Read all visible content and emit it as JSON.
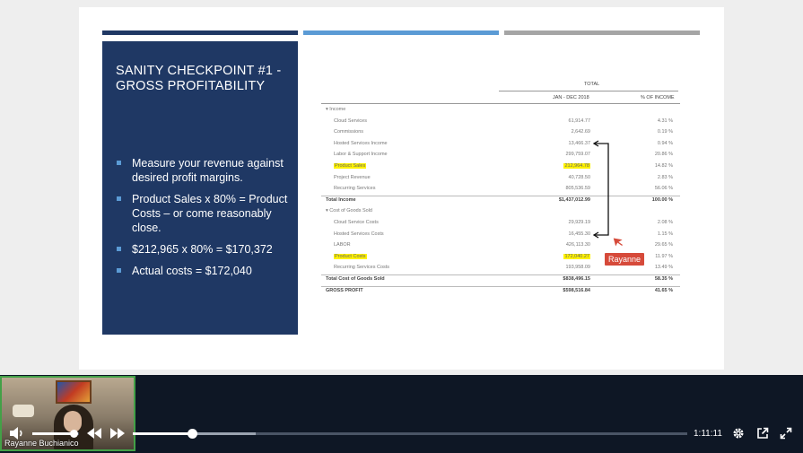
{
  "slide": {
    "title": "SANITY CHECKPOINT #1 -\nGROSS PROFITABILITY",
    "bullets": [
      "Measure your revenue against desired profit margins.",
      "Product Sales x 80% = Product Costs – or come reasonably close.",
      "$212,965 x 80% = $170,372",
      "Actual costs = $172,040"
    ],
    "colors": {
      "panel": "#1f3864",
      "bar_accent": "#5b9bd5",
      "bar_gray": "#a5a5a5",
      "highlight": "#fff200"
    }
  },
  "report": {
    "col_total": "TOTAL",
    "col_period": "JAN - DEC 2018",
    "col_pct": "% OF INCOME",
    "rows": [
      {
        "label": "▾ Income",
        "amount": "",
        "pct": "",
        "indent": 0
      },
      {
        "label": "Cloud Services",
        "amount": "61,914.77",
        "pct": "4.31 %",
        "indent": 1
      },
      {
        "label": "Commissions",
        "amount": "2,642.69",
        "pct": "0.19 %",
        "indent": 1
      },
      {
        "label": "Hosted Services Income",
        "amount": "13,466.37",
        "pct": "0.94 %",
        "indent": 1
      },
      {
        "label": "Labor & Support Income",
        "amount": "299,759.07",
        "pct": "20.86 %",
        "indent": 1
      },
      {
        "label": "Product Sales",
        "amount": "212,964.78",
        "pct": "14.82 %",
        "indent": 1,
        "highlight": true
      },
      {
        "label": "Project Revenue",
        "amount": "40,728.50",
        "pct": "2.83 %",
        "indent": 1
      },
      {
        "label": "Recurring Services",
        "amount": "805,536.59",
        "pct": "56.06 %",
        "indent": 1
      },
      {
        "label": "Total Income",
        "amount": "$1,437,012.99",
        "pct": "100.00 %",
        "indent": 0,
        "total": true
      },
      {
        "label": "▾ Cost of Goods Sold",
        "amount": "",
        "pct": "",
        "indent": 0
      },
      {
        "label": "Cloud Service Costs",
        "amount": "29,929.19",
        "pct": "2.08 %",
        "indent": 1
      },
      {
        "label": "Hosted Services Costs",
        "amount": "16,455.30",
        "pct": "1.15 %",
        "indent": 1
      },
      {
        "label": "LABOR",
        "amount": "426,113.30",
        "pct": "29.65 %",
        "indent": 1
      },
      {
        "label": "Product Costs",
        "amount": "172,040.27",
        "pct": "11.97 %",
        "indent": 1,
        "highlight": true
      },
      {
        "label": "Recurring Services Costs",
        "amount": "193,958.09",
        "pct": "13.49 %",
        "indent": 1
      },
      {
        "label": "Total Cost of Goods Sold",
        "amount": "$838,496.15",
        "pct": "58.35 %",
        "indent": 0,
        "total": true
      },
      {
        "label": "GROSS PROFIT",
        "amount": "$598,516.84",
        "pct": "41.65 %",
        "indent": 0,
        "total": true
      }
    ]
  },
  "annotation": {
    "tag": "Rayanne",
    "color": "#d64a3a"
  },
  "webcam": {
    "name": "Rayanne Buchianico"
  },
  "player": {
    "time": "1:11:11",
    "progress_fraction": 0.107,
    "buffered_fraction": 0.22,
    "volume_fraction": 0.88,
    "icons": [
      "volume-icon",
      "rewind-icon",
      "fast-forward-icon",
      "gear-icon",
      "popout-icon",
      "fullscreen-icon"
    ]
  }
}
